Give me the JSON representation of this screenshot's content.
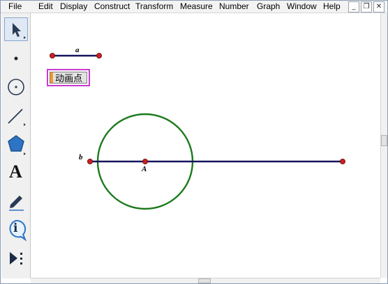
{
  "menubar": {
    "items": [
      "File",
      "Edit",
      "Display",
      "Construct",
      "Transform",
      "Measure",
      "Number",
      "Graph",
      "Window",
      "Help"
    ]
  },
  "window_controls": {
    "minimize": "_",
    "restore": "❐",
    "close": "✕"
  },
  "toolbox": {
    "tools": [
      "arrow-selection-tool",
      "point-tool",
      "compass-tool",
      "straightedge-tool",
      "polygon-tool",
      "text-tool",
      "marker-tool",
      "information-tool",
      "custom-tool"
    ],
    "text_tool_glyph": "A",
    "info_tool_glyph": "i",
    "selected": "arrow-selection-tool"
  },
  "sketch": {
    "segment_a_label": "a",
    "segment_b_label": "b",
    "point_A_label": "A",
    "animation_button_label": "动画点",
    "colors": {
      "segment": "#13135e",
      "point": "#cc1f1f",
      "circle": "#1c7a1c",
      "button_border": "#c83ad0",
      "handle": "#f09a28"
    }
  }
}
